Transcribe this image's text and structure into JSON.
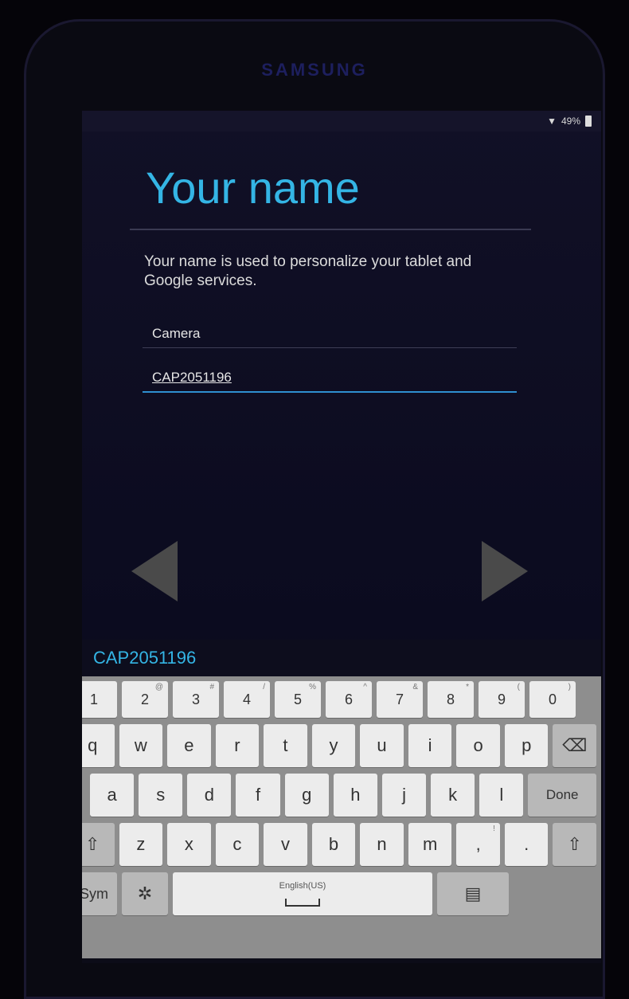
{
  "device": {
    "brand": "SAMSUNG"
  },
  "status_bar": {
    "signal_icon": "wifi-icon",
    "battery": "49%"
  },
  "page": {
    "title": "Your name",
    "description": "Your name is used to personalize your tablet and Google services.",
    "first_name": "Camera",
    "last_name": "CAP2051196"
  },
  "navigation": {
    "prev_icon": "arrow-left-icon",
    "next_icon": "arrow-right-icon"
  },
  "keyboard": {
    "suggestion": "CAP2051196",
    "number_row": [
      {
        "k": "1",
        "s": ""
      },
      {
        "k": "2",
        "s": "@"
      },
      {
        "k": "3",
        "s": "#"
      },
      {
        "k": "4",
        "s": "/"
      },
      {
        "k": "5",
        "s": "%"
      },
      {
        "k": "6",
        "s": "^"
      },
      {
        "k": "7",
        "s": "&"
      },
      {
        "k": "8",
        "s": "*"
      },
      {
        "k": "9",
        "s": "("
      },
      {
        "k": "0",
        "s": ")"
      }
    ],
    "row1": [
      "q",
      "w",
      "e",
      "r",
      "t",
      "y",
      "u",
      "i",
      "o",
      "p"
    ],
    "row2": [
      "a",
      "s",
      "d",
      "f",
      "g",
      "h",
      "j",
      "k",
      "l"
    ],
    "row3": [
      "z",
      "x",
      "c",
      "v",
      "b",
      "n",
      "m",
      ",",
      "."
    ],
    "row3_subs": {
      ",": "!",
      ".": "?"
    },
    "done_label": "Done",
    "sym_label": "Sym",
    "space_label": "English(US)",
    "shift_glyph": "⇧",
    "backspace_glyph": "⌫",
    "settings_glyph": "✲",
    "clipboard_glyph": "▤"
  }
}
